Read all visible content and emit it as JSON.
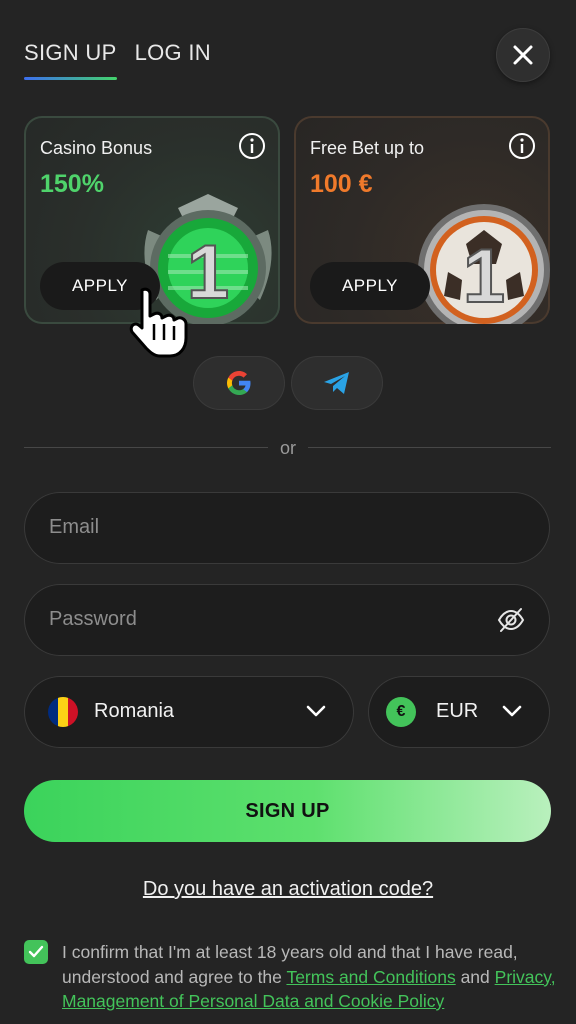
{
  "tabs": {
    "signup": "SIGN UP",
    "login": "LOG IN",
    "active": "signup"
  },
  "bonuses": {
    "casino": {
      "title": "Casino Bonus",
      "amount": "150%",
      "apply": "APPLY",
      "medal_number": "1"
    },
    "sport": {
      "title": "Free Bet up to",
      "amount": "100 €",
      "apply": "APPLY",
      "medal_number": "1"
    }
  },
  "social": {
    "google_icon": "google-icon",
    "telegram_icon": "telegram-icon"
  },
  "divider_text": "or",
  "form": {
    "email_placeholder": "Email",
    "password_placeholder": "Password",
    "country": "Romania",
    "currency_symbol": "€",
    "currency": "EUR",
    "submit": "SIGN UP"
  },
  "activation_link": "Do you have an activation code?",
  "consent": {
    "checked": true,
    "text_1": "I confirm that I'm at least 18 years old and that I have read, understood and agree to the ",
    "terms_link": "Terms and Conditions",
    "text_2": " and ",
    "privacy_link": "Privacy, Management of Personal Data and Cookie Policy"
  },
  "colors": {
    "accent_green": "#43c35a",
    "accent_orange": "#f07a2b",
    "tab_underline_start": "#3d6ff0"
  }
}
